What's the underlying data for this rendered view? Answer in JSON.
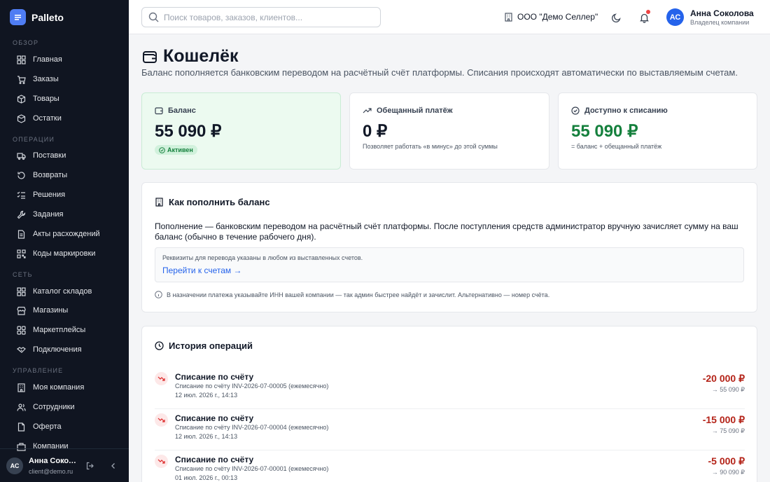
{
  "brand": {
    "name": "Palleto"
  },
  "sidebar": {
    "sections": [
      {
        "title": "ОБЗОР",
        "items": [
          {
            "label": "Главная",
            "icon": "dashboard-icon"
          },
          {
            "label": "Заказы",
            "icon": "orders-icon"
          },
          {
            "label": "Товары",
            "icon": "box-icon"
          },
          {
            "label": "Остатки",
            "icon": "stock-icon"
          }
        ]
      },
      {
        "title": "ОПЕРАЦИИ",
        "items": [
          {
            "label": "Поставки",
            "icon": "truck-icon"
          },
          {
            "label": "Возвраты",
            "icon": "return-icon"
          },
          {
            "label": "Решения",
            "icon": "checklist-icon"
          },
          {
            "label": "Задания",
            "icon": "wrench-icon"
          },
          {
            "label": "Акты расхождений",
            "icon": "doc-icon"
          },
          {
            "label": "Коды маркировки",
            "icon": "qr-icon"
          }
        ]
      },
      {
        "title": "СЕТЬ",
        "items": [
          {
            "label": "Каталог складов",
            "icon": "warehouse-icon"
          },
          {
            "label": "Магазины",
            "icon": "store-icon"
          },
          {
            "label": "Маркетплейсы",
            "icon": "grid-icon"
          },
          {
            "label": "Подключения",
            "icon": "handshake-icon"
          }
        ]
      },
      {
        "title": "УПРАВЛЕНИЕ",
        "items": [
          {
            "label": "Моя компания",
            "icon": "building-icon"
          },
          {
            "label": "Сотрудники",
            "icon": "users-icon"
          },
          {
            "label": "Оферта",
            "icon": "file-icon"
          },
          {
            "label": "Компании",
            "icon": "company-icon"
          }
        ]
      }
    ],
    "footer": {
      "initials": "АС",
      "name": "Анна Соколова",
      "email": "client@demo.ru"
    }
  },
  "topbar": {
    "search_placeholder": "Поиск товаров, заказов, клиентов...",
    "company": "ООО \"Демо Селлер\"",
    "user": {
      "initials": "АС",
      "name": "Анна Соколова",
      "role": "Владелец компании"
    }
  },
  "page": {
    "title": "Кошелёк",
    "subtitle": "Баланс пополняется банковским переводом на расчётный счёт платформы. Списания происходят автоматически по выставляемым счетам."
  },
  "stats": {
    "balance": {
      "label": "Баланс",
      "value": "55 090 ₽",
      "badge": "Активен"
    },
    "promised": {
      "label": "Обещанный платёж",
      "value": "0 ₽",
      "hint": "Позволяет работать «в минус» до этой суммы"
    },
    "available": {
      "label": "Доступно к списанию",
      "value": "55 090 ₽",
      "hint": "= баланс + обещанный платёж"
    }
  },
  "howto": {
    "title": "Как пополнить баланс",
    "text": "Пополнение — банковским переводом на расчётный счёт платформы. После поступления средств администратор вручную зачисляет сумму на ваш баланс (обычно в течение рабочего дня).",
    "note": "Реквизиты для перевода указаны в любом из выставленных счетов.",
    "link": "Перейти к счетам →",
    "tip": "В назначении платежа указывайте ИНН вашей компании — так админ быстрее найдёт и зачислит. Альтернативно — номер счёта."
  },
  "history": {
    "title": "История операций",
    "rows": [
      {
        "title": "Списание по счёту",
        "desc": "Списание по счёту INV-2026-07-00005 (ежемесячно)",
        "date": "12 июл. 2026 г., 14:13",
        "amount": "-20 000 ₽",
        "after": "→ 55 090 ₽"
      },
      {
        "title": "Списание по счёту",
        "desc": "Списание по счёту INV-2026-07-00004 (ежемесячно)",
        "date": "12 июл. 2026 г., 14:13",
        "amount": "-15 000 ₽",
        "after": "→ 75 090 ₽"
      },
      {
        "title": "Списание по счёту",
        "desc": "Списание по счёту INV-2026-07-00001 (ежемесячно)",
        "date": "01 июл. 2026 г., 00:13",
        "amount": "-5 000 ₽",
        "after": "→ 90 090 ₽"
      }
    ]
  },
  "colors": {
    "accent": "#2563eb",
    "sidebar": "#101521",
    "positive": "#15803d",
    "negative": "#b42318"
  }
}
